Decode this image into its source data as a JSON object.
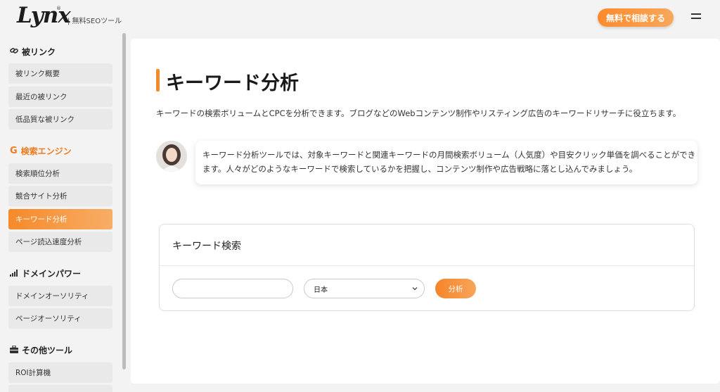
{
  "header": {
    "logo": "Lynx",
    "logo_mark": "®",
    "tagline": "| 無料SEOツール",
    "cta_label": "無料で相談する"
  },
  "sidebar": {
    "sections": [
      {
        "title": "被リンク",
        "icon": "link-icon",
        "items": [
          "被リンク概要",
          "最近の被リンク",
          "低品質な被リンク"
        ]
      },
      {
        "title": "検索エンジン",
        "icon": "google-g-icon",
        "items": [
          "検索順位分析",
          "競合サイト分析",
          "キーワード分析",
          "ページ読込速度分析"
        ]
      },
      {
        "title": "ドメインパワー",
        "icon": "signal-bars-icon",
        "items": [
          "ドメインオーソリティ",
          "ページオーソリティ"
        ]
      },
      {
        "title": "その他ツール",
        "icon": "toolbox-icon",
        "items": [
          "ROI計算機"
        ]
      }
    ],
    "active_item": "キーワード分析"
  },
  "main": {
    "title": "キーワード分析",
    "description": "キーワードの検索ボリュームとCPCを分析できます。ブログなどのWebコンテンツ制作やリスティング広告のキーワードリサーチに役立ちます。",
    "bubble_text": "キーワード分析ツールでは、対象キーワードと関連キーワードの月間検索ボリューム（人気度）や目安クリック単価を調べることができます。人々がどのようなキーワードで検索しているかを把握し、コンテンツ制作や広告戦略に落とし込んでみましょう。",
    "search_card": {
      "title": "キーワード検索",
      "input_value": "",
      "input_placeholder": "",
      "country_selected": "日本",
      "analyze_label": "分析"
    }
  },
  "colors": {
    "accent": "#f58a2a",
    "accent_light": "#f8ad66"
  }
}
